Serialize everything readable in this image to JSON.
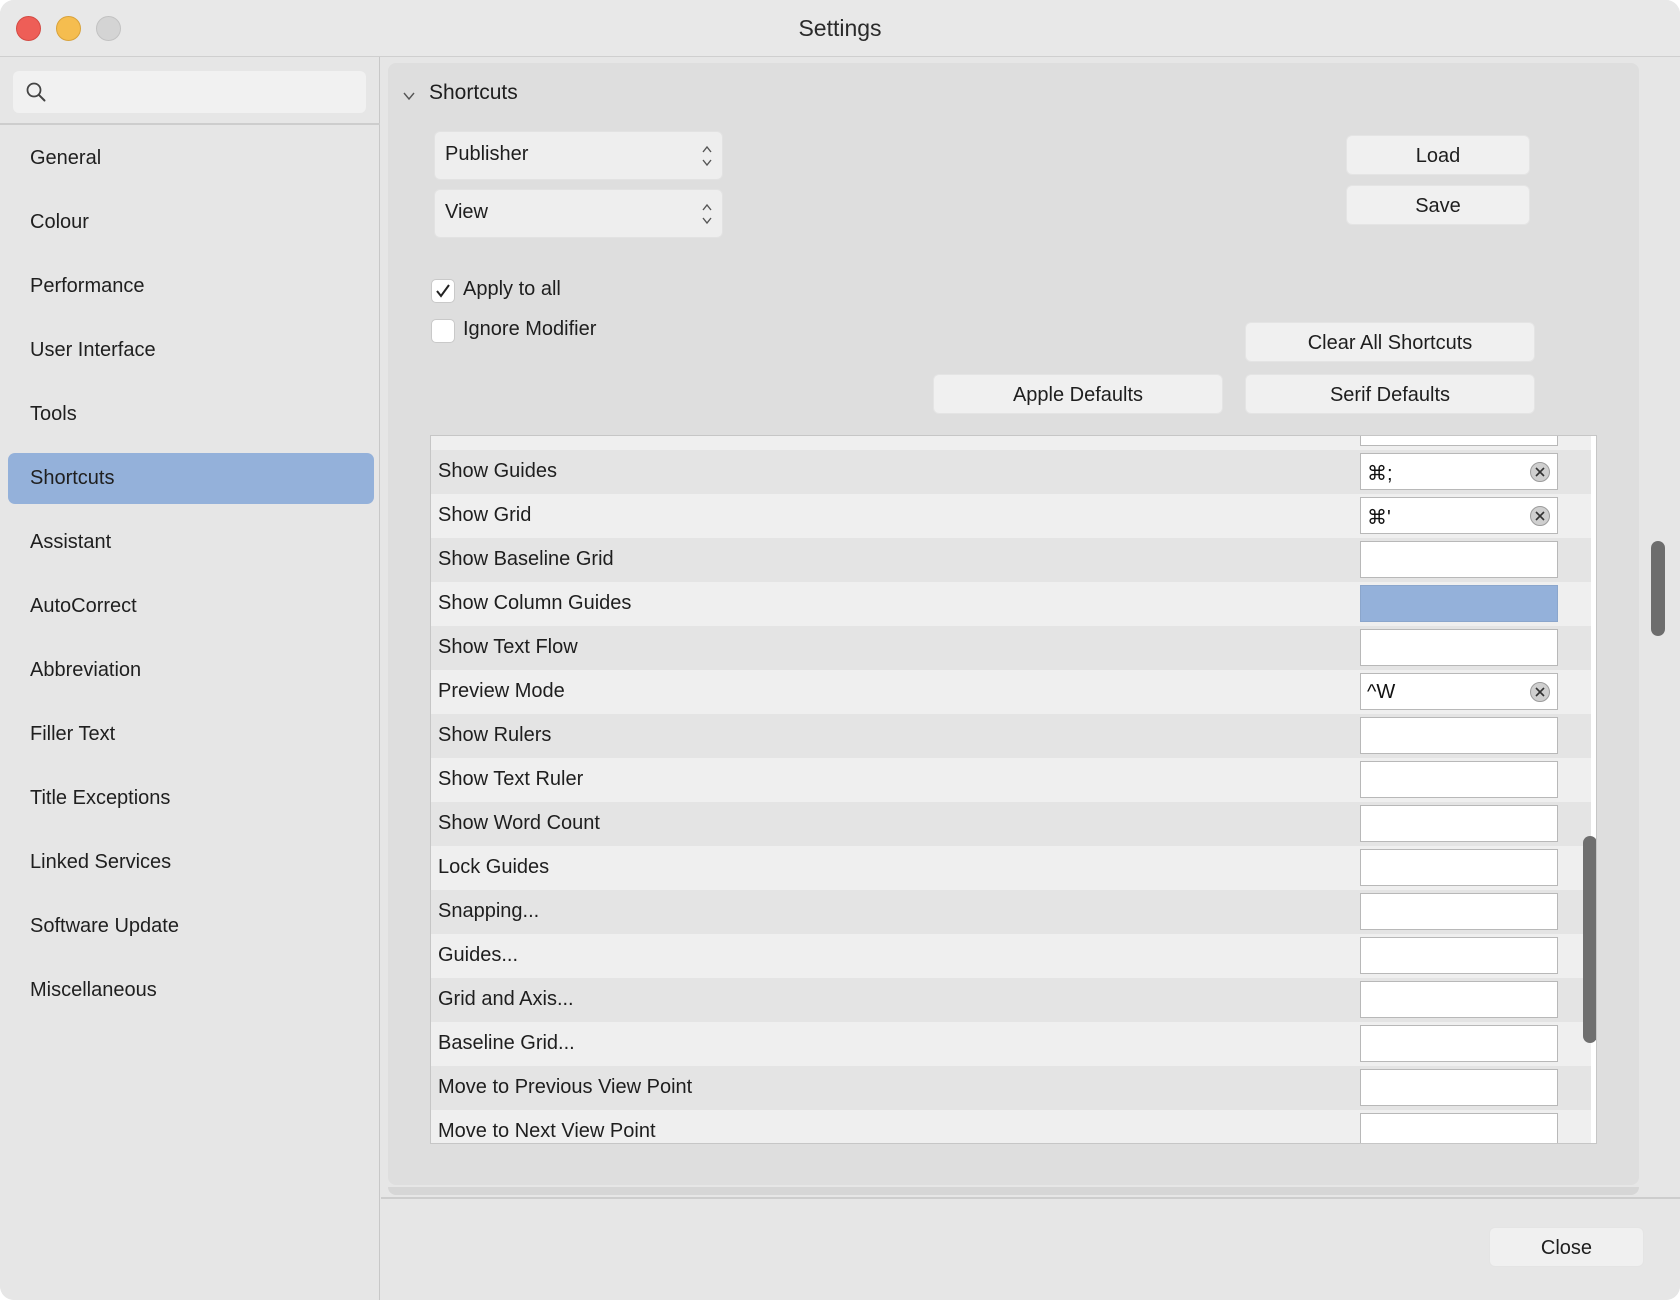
{
  "window": {
    "title": "Settings"
  },
  "search": {
    "placeholder": "",
    "value": ""
  },
  "sidebar": {
    "items": [
      {
        "label": "General",
        "selected": false
      },
      {
        "label": "Colour",
        "selected": false
      },
      {
        "label": "Performance",
        "selected": false
      },
      {
        "label": "User Interface",
        "selected": false
      },
      {
        "label": "Tools",
        "selected": false
      },
      {
        "label": "Shortcuts",
        "selected": true
      },
      {
        "label": "Assistant",
        "selected": false
      },
      {
        "label": "AutoCorrect",
        "selected": false
      },
      {
        "label": "Abbreviation",
        "selected": false
      },
      {
        "label": "Filler Text",
        "selected": false
      },
      {
        "label": "Title Exceptions",
        "selected": false
      },
      {
        "label": "Linked Services",
        "selected": false
      },
      {
        "label": "Software Update",
        "selected": false
      },
      {
        "label": "Miscellaneous",
        "selected": false
      }
    ]
  },
  "section": {
    "title": "Shortcuts",
    "expanded": true
  },
  "popups": {
    "application": "Publisher",
    "category": "View"
  },
  "buttons": {
    "load": "Load",
    "save": "Save",
    "clear_all": "Clear All Shortcuts",
    "apple_defaults": "Apple Defaults",
    "serif_defaults": "Serif Defaults",
    "close": "Close"
  },
  "checkboxes": {
    "apply_to_all": {
      "label": "Apply to all",
      "checked": true
    },
    "ignore_modifier": {
      "label": "Ignore Modifier",
      "checked": false
    }
  },
  "shortcuts": [
    {
      "label": "",
      "key": ""
    },
    {
      "label": "Show Guides",
      "key": "⌘;"
    },
    {
      "label": "Show Grid",
      "key": "⌘'"
    },
    {
      "label": "Show Baseline Grid",
      "key": ""
    },
    {
      "label": "Show Column Guides",
      "key": "",
      "active": true
    },
    {
      "label": "Show Text Flow",
      "key": ""
    },
    {
      "label": "Preview Mode",
      "key": "^W"
    },
    {
      "label": "Show Rulers",
      "key": ""
    },
    {
      "label": "Show Text Ruler",
      "key": ""
    },
    {
      "label": "Show Word Count",
      "key": ""
    },
    {
      "label": "Lock Guides",
      "key": ""
    },
    {
      "label": "Snapping...",
      "key": ""
    },
    {
      "label": "Guides...",
      "key": ""
    },
    {
      "label": "Grid and Axis...",
      "key": ""
    },
    {
      "label": "Baseline Grid...",
      "key": ""
    },
    {
      "label": "Move to Previous View Point",
      "key": ""
    },
    {
      "label": "Move to Next View Point",
      "key": ""
    }
  ],
  "colors": {
    "selection": "#94b1da",
    "close_light": "#ee5e57",
    "minimize_light": "#f5bd4f"
  }
}
